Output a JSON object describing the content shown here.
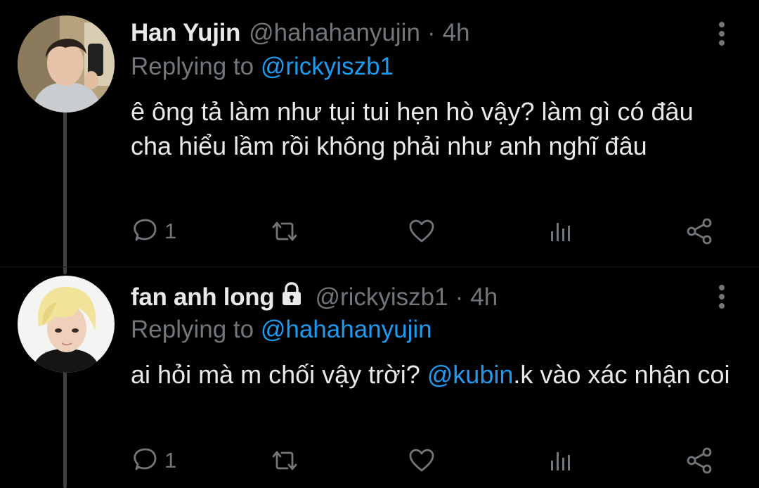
{
  "tweets": [
    {
      "display_name": "Han Yujin",
      "handle": "@hahahanyujin",
      "separator": "·",
      "time": "4h",
      "locked": false,
      "replying_label": "Replying to",
      "replying_to": "@rickyiszb1",
      "body_before_mention": "ê ông tả làm như tụi tui hẹn hò vậy? làm gì có đâu cha hiểu lầm rồi không phải như anh nghĩ đâu",
      "body_mention": "",
      "body_after_mention": "",
      "reply_count": "1",
      "avatar": "photo of a young man with a phone (mirror selfie)"
    },
    {
      "display_name": "fan anh long",
      "handle": "@rickyiszb1",
      "separator": "·",
      "time": "4h",
      "locked": true,
      "replying_label": "Replying to",
      "replying_to": "@hahahanyujin",
      "body_before_mention": "ai hỏi mà m chối vậy trời? ",
      "body_mention": "@kubin",
      "body_after_mention": ".k vào xác nhận coi",
      "reply_count": "1",
      "avatar": "photo of a person with blonde hair"
    }
  ],
  "icons": {
    "reply": "reply-icon",
    "retweet": "retweet-icon",
    "like": "heart-icon",
    "views": "views-icon",
    "share": "share-icon",
    "more": "more-vertical-icon",
    "lock": "lock-icon"
  },
  "colors": {
    "background": "#000000",
    "text": "#e7e9ea",
    "secondary": "#71767b",
    "mention": "#1d9bf0",
    "thread_line": "#3d4247"
  }
}
